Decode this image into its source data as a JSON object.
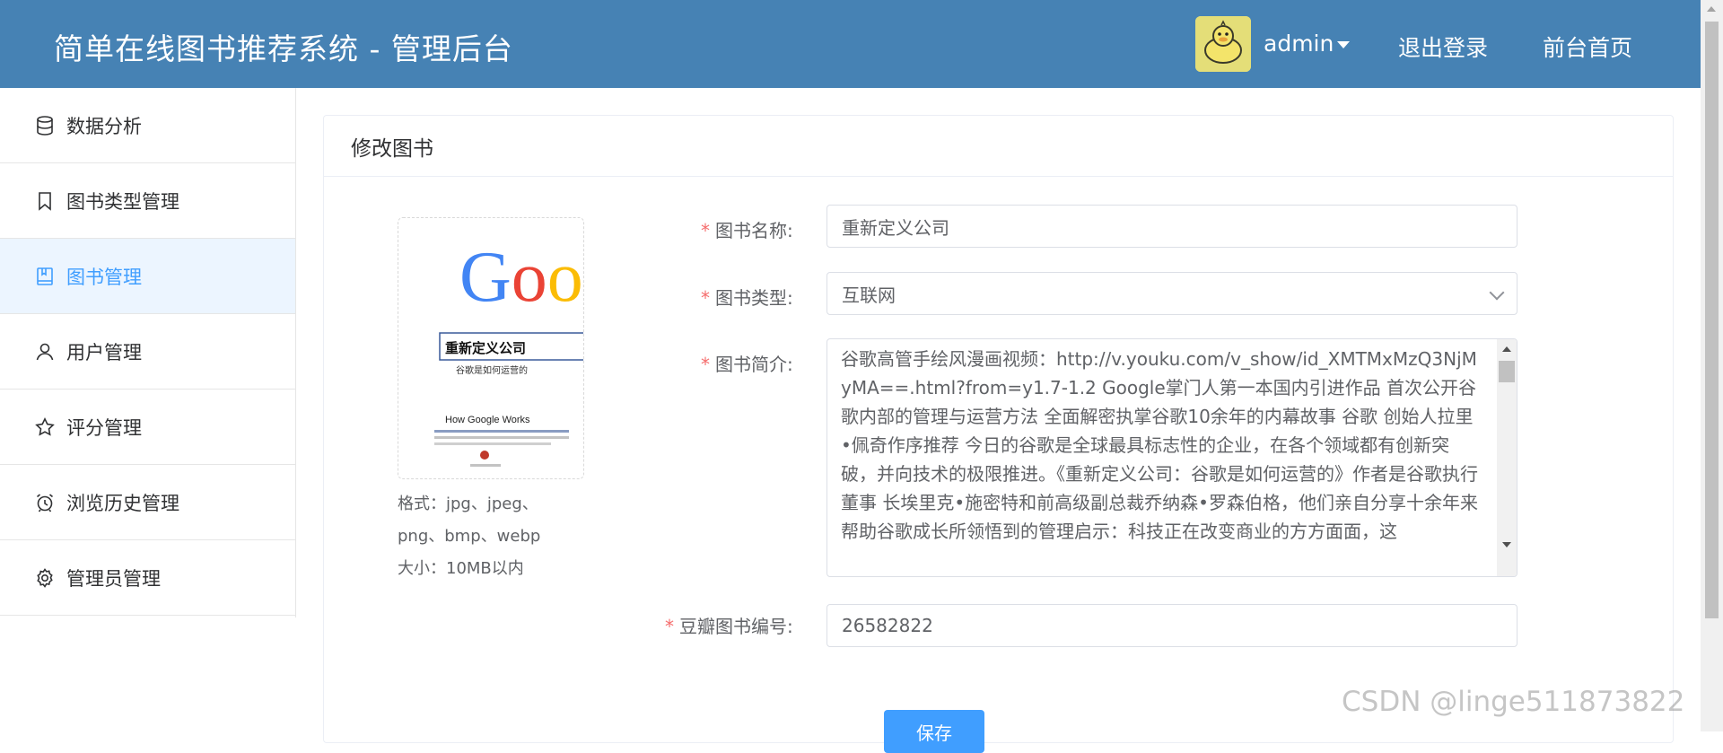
{
  "header": {
    "title": "简单在线图书推荐系统 - 管理后台",
    "username": "admin",
    "logout": "退出登录",
    "frontend_home": "前台首页"
  },
  "sidebar": {
    "items": [
      {
        "label": "数据分析",
        "icon": "database-icon"
      },
      {
        "label": "图书类型管理",
        "icon": "bookmark-icon"
      },
      {
        "label": "图书管理",
        "icon": "book-icon",
        "active": true
      },
      {
        "label": "用户管理",
        "icon": "user-icon"
      },
      {
        "label": "评分管理",
        "icon": "star-icon"
      },
      {
        "label": "浏览历史管理",
        "icon": "alarm-clock-icon"
      },
      {
        "label": "管理员管理",
        "icon": "gear-icon"
      }
    ]
  },
  "card": {
    "title": "修改图书"
  },
  "cover": {
    "logo_text": "Goo",
    "book_title": "重新定义公司",
    "subtitle": "谷歌是如何运营的",
    "english_title": "How Google Works",
    "format_hint_1": "格式：jpg、jpeg、",
    "format_hint_2": "png、bmp、webp",
    "size_hint": "大小：10MB以内"
  },
  "form": {
    "name_label": "图书名称:",
    "name_value": "重新定义公司",
    "type_label": "图书类型:",
    "type_value": "互联网",
    "intro_label": "图书简介:",
    "intro_value": "谷歌高管手绘风漫画视频：http://v.youku.com/v_show/id_XMTMxMzQ3NjMyMA==.html?from=y1.7-1.2 Google掌门人第一本国内引进作品 首次公开谷歌内部的管理与运营方法 全面解密执掌谷歌10余年的内幕故事 谷歌 创始人拉里•佩奇作序推荐 今日的谷歌是全球最具标志性的企业，在各个领域都有创新突破，并向技术的极限推进。《重新定义公司：谷歌是如何运营的》作者是谷歌执行董事 长埃里克•施密特和前高级副总裁乔纳森•罗森伯格，他们亲自分享十余年来帮助谷歌成长所领悟到的管理启示：科技正在改变商业的方方面面，这",
    "douban_label": "豆瓣图书编号:",
    "douban_value": "26582822",
    "save": "保存"
  },
  "watermark": "CSDN @linge511873822",
  "colors": {
    "header_bg": "#4682b4",
    "primary": "#409eff",
    "active_bg": "#ecf5ff",
    "required": "#f56c6c"
  }
}
